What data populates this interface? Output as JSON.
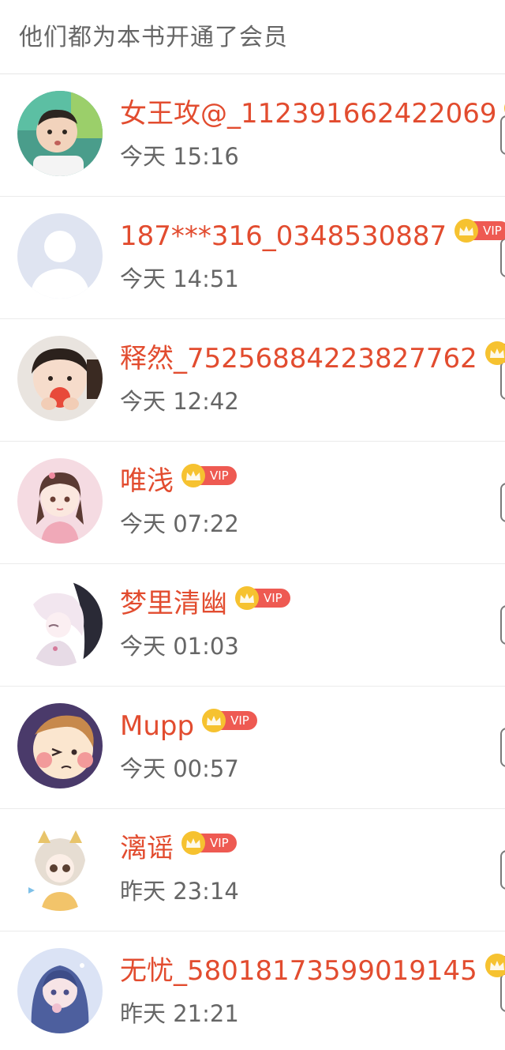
{
  "header": {
    "title": "他们都为本书开通了会员"
  },
  "vip": {
    "label": "VIP",
    "crown_color": "#f6c230",
    "pill_color": "#ee5a52"
  },
  "colors": {
    "name": "#e24c2f",
    "time": "#666666",
    "header_text": "#666666"
  },
  "members": [
    {
      "name": "女王攻@_112391662422069",
      "time": "今天 15:16",
      "avatar": "child-photo-avatar",
      "vip": true
    },
    {
      "name": "187***316_0348530887",
      "time": "今天 14:51",
      "avatar": "default-person-avatar",
      "vip": true
    },
    {
      "name": "释然_75256884223827762",
      "time": "今天 12:42",
      "avatar": "toddler-photo-avatar",
      "vip": true
    },
    {
      "name": "唯浅",
      "time": "今天 07:22",
      "avatar": "anime-girl-avatar",
      "vip": true
    },
    {
      "name": "梦里清幽",
      "time": "今天 01:03",
      "avatar": "anime-white-hair-avatar",
      "vip": true
    },
    {
      "name": "Mupp",
      "time": "今天 00:57",
      "avatar": "cartoon-face-avatar",
      "vip": true
    },
    {
      "name": "漓谣",
      "time": "昨天 23:14",
      "avatar": "chibi-cat-avatar",
      "vip": true
    },
    {
      "name": "无忧_58018173599019145",
      "time": "昨天 21:21",
      "avatar": "blue-hair-girl-avatar",
      "vip": true
    }
  ]
}
